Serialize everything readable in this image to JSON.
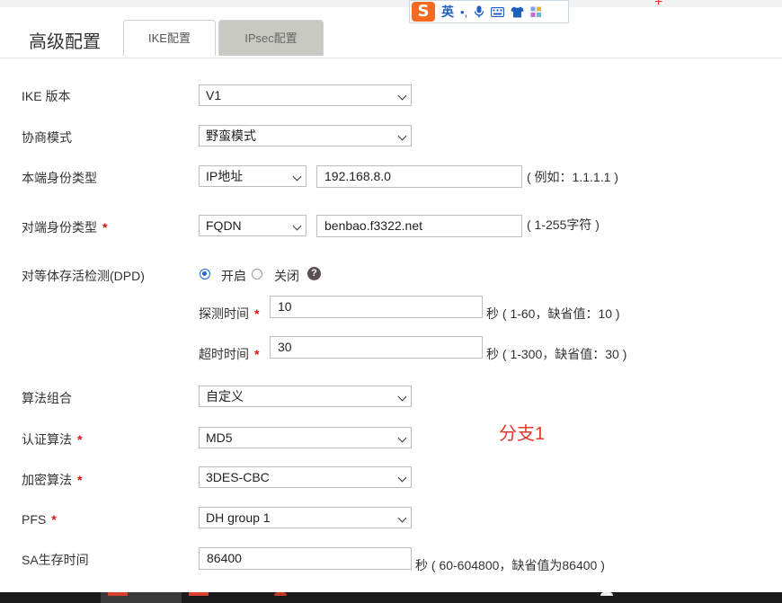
{
  "header": {
    "title": "高级配置",
    "tabs": [
      {
        "label": "IKE配置",
        "active": true
      },
      {
        "label": "IPsec配置",
        "active": false
      }
    ],
    "corner_glyph": "+"
  },
  "ime_toolbar": {
    "logo": "S",
    "lang": "英",
    "icons": [
      "punctuation-icon",
      "microphone-icon",
      "keyboard-icon",
      "skin-icon",
      "toolbox-icon"
    ],
    "punct": "•,"
  },
  "form": {
    "ike_version": {
      "label": "IKE 版本",
      "value": "V1"
    },
    "negotiation_mode": {
      "label": "协商模式",
      "value": "野蛮模式"
    },
    "local_id": {
      "label": "本端身份类型",
      "type": "IP地址",
      "value": "192.168.8.0",
      "hint": "( 例如：1.1.1.1 )"
    },
    "peer_id": {
      "label": "对端身份类型",
      "required": "*",
      "type": "FQDN",
      "value": "benbao.f3322.net",
      "hint": "( 1-255字符 )"
    },
    "dpd": {
      "label": "对等体存活检测(DPD)",
      "on_label": "开启",
      "off_label": "关闭",
      "help": "?",
      "probe": {
        "label": "探测时间",
        "required": "*",
        "value": "10",
        "hint": "秒 ( 1-60，缺省值：10 )"
      },
      "timeout": {
        "label": "超时时间",
        "required": "*",
        "value": "30",
        "hint": "秒 ( 1-300，缺省值：30 )"
      }
    },
    "algorithm_suite": {
      "label": "算法组合",
      "value": "自定义"
    },
    "auth_algorithm": {
      "label": "认证算法",
      "required": "*",
      "value": "MD5"
    },
    "encryption_algorithm": {
      "label": "加密算法",
      "required": "*",
      "value": "3DES-CBC"
    },
    "pfs": {
      "label": "PFS",
      "required": "*",
      "value": "DH group 1"
    },
    "sa_lifetime": {
      "label": "SA生存时间",
      "value": "86400",
      "hint": "秒 ( 60-604800，缺省值为86400 )"
    }
  },
  "annotation": "分支1",
  "colors": {
    "accent": "#1e63d6",
    "required": "#d11111",
    "annotation": "#e03a2b",
    "tab_inactive": "#c9c9c4"
  }
}
